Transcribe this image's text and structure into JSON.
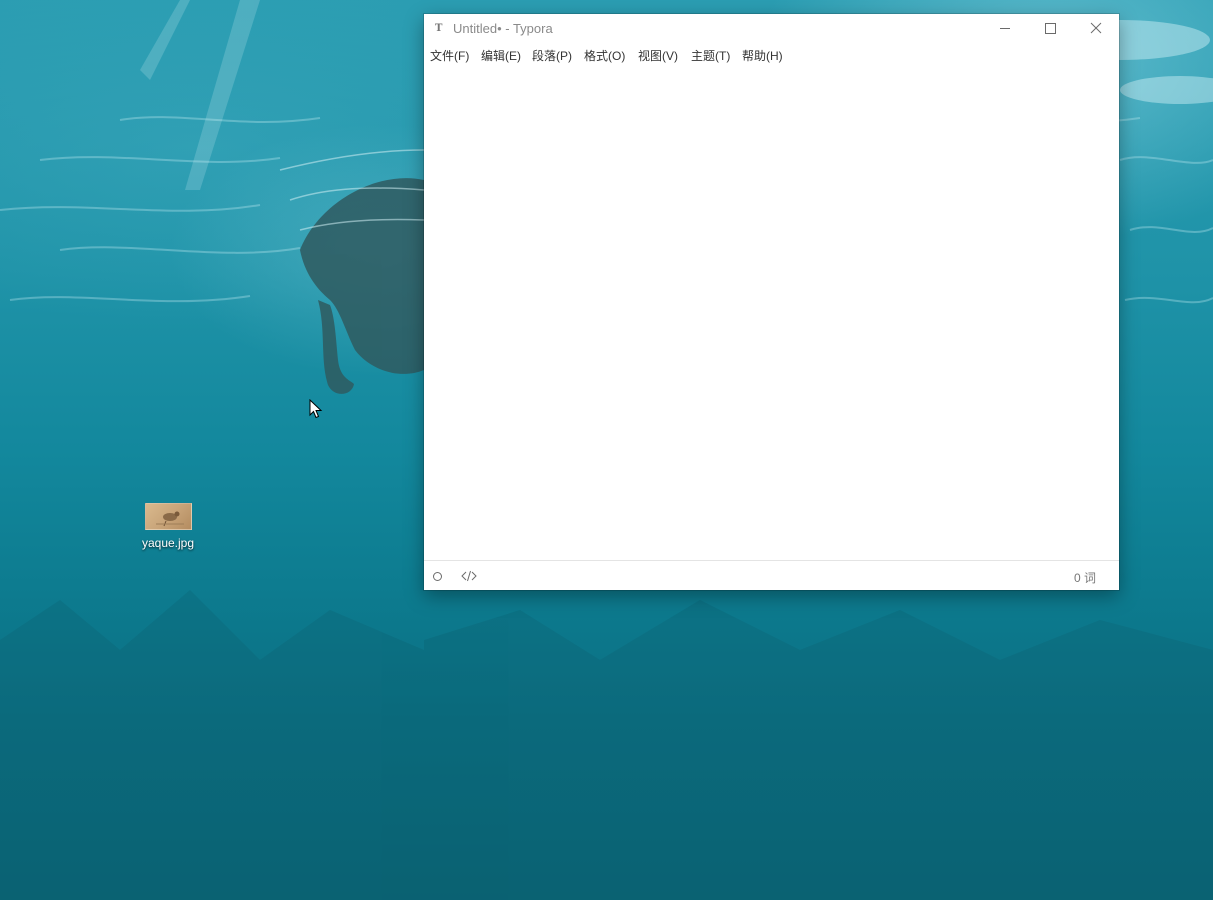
{
  "desktop": {
    "icons": [
      {
        "label": "yaque.jpg",
        "icon": "image-file-thumbnail-icon"
      }
    ],
    "cursor": "arrow-cursor"
  },
  "window": {
    "app_icon_text": "T",
    "title": "Untitled• - Typora",
    "buttons": {
      "minimize": "minimize-icon",
      "maximize": "maximize-icon",
      "close": "close-icon"
    },
    "menu": [
      "文件(F)",
      "编辑(E)",
      "段落(P)",
      "格式(O)",
      "视图(V)",
      "主题(T)",
      "帮助(H)"
    ],
    "editor_content": "",
    "statusbar": {
      "outline_toggle": "circle-icon",
      "source_toggle": "code-icon",
      "word_count": "0 词"
    }
  },
  "colors": {
    "water_top": "#2b9db2",
    "water_bottom": "#0a6475",
    "window_bg": "#ffffff",
    "title_text": "#8a8a8a",
    "menu_text": "#333333"
  }
}
